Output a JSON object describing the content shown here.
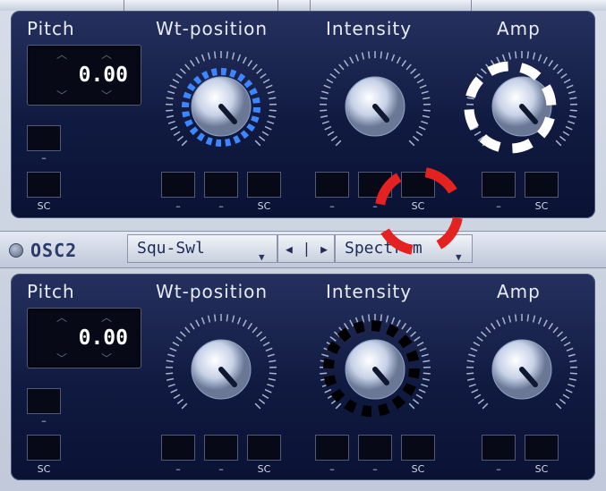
{
  "osc1": {
    "labels": {
      "pitch": "Pitch",
      "wt_position": "Wt-position",
      "intensity": "Intensity",
      "amp": "Amp"
    },
    "pitch_value": "0.00",
    "tags": {
      "dash": "–",
      "sc": "SC"
    }
  },
  "osc_bar": {
    "name": "OSC2",
    "waveform": "Squ-Swl",
    "nav_prev": "◀",
    "nav_sep": "|",
    "nav_next": "▶",
    "mode": "Spectrum"
  },
  "osc2": {
    "labels": {
      "pitch": "Pitch",
      "wt_position": "Wt-position",
      "intensity": "Intensity",
      "amp": "Amp"
    },
    "pitch_value": "0.00",
    "tags": {
      "dash": "–",
      "sc": "SC"
    }
  },
  "colors": {
    "panel": "#1a2450",
    "highlight_blue": "#3e86ff",
    "highlight_red": "#e42222",
    "highlight_white": "#ffffff",
    "highlight_black": "#000000"
  }
}
